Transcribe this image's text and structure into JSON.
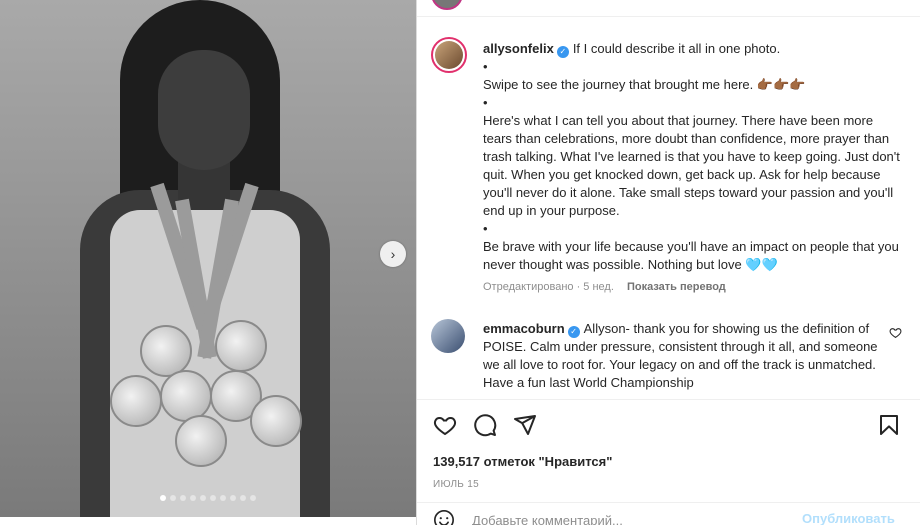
{
  "post": {
    "image_alt": "",
    "carousel": {
      "total": 10,
      "active_index": 0
    }
  },
  "caption": {
    "username": "allysonfelix",
    "lines": [
      "If I could describe it all in one photo.",
      "•",
      "Swipe to see the journey that brought me here. 👉🏾👉🏾👉🏾",
      "•",
      "Here's what I can tell you about that journey. There have been more tears than celebrations, more doubt than confidence, more prayer than trash talking. What I've learned is that you have to keep going. Just don't quit. When you get knocked down, get back up. Ask for help because you'll never do it alone. Take small steps toward your passion and you'll end up in your purpose.",
      "•",
      "Be brave with your life because you'll have an impact on people that you never thought was possible. Nothing but love 🩵🩵"
    ],
    "edited_label": "Отредактировано · 5 нед.",
    "translate_label": "Показать перевод"
  },
  "comments": [
    {
      "username": "emmacoburn",
      "text": "Allyson- thank you for showing us the definition of POISE. Calm under pressure, consistent through it all, and someone we all love to root for. Your legacy on and off the track is unmatched. Have a fun last World Championship"
    }
  ],
  "likes_label": "139,517 отметок \"Нравится\"",
  "date_label": "ИЮЛЬ 15",
  "comment_box": {
    "placeholder": "Добавьте комментарий...",
    "post_label": "Опубликовать"
  },
  "colors": {
    "verified": "#3897f0",
    "post_button_disabled": "#b2dffc",
    "story_ring": "#e1306c"
  }
}
